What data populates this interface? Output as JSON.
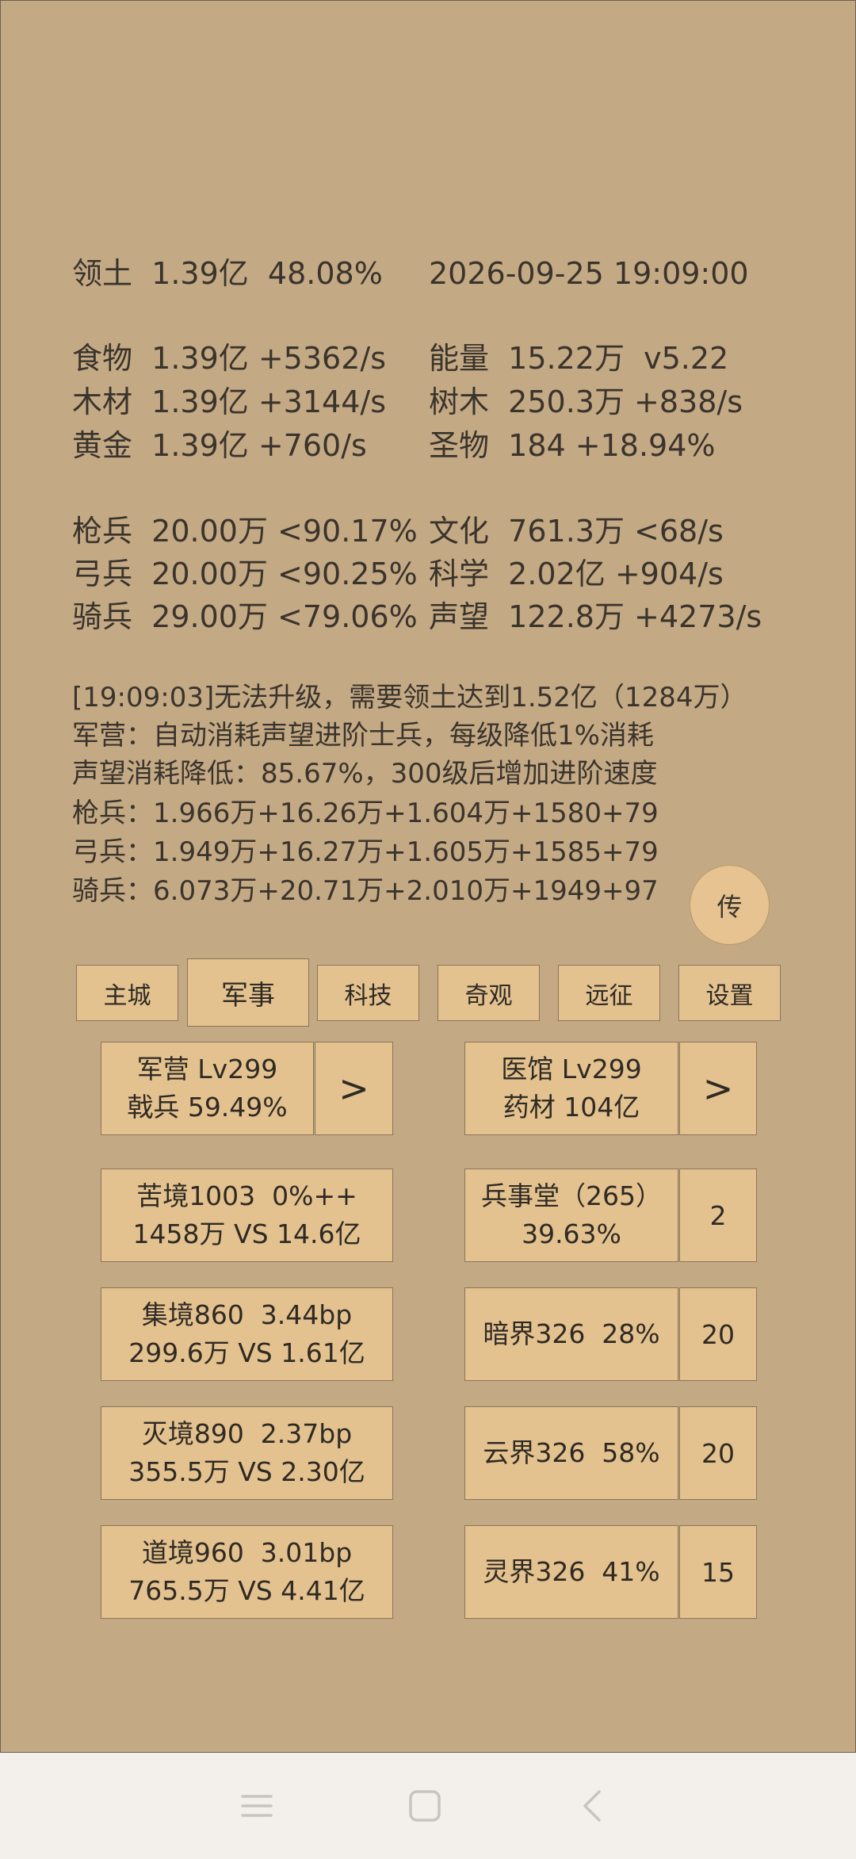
{
  "header": {
    "territory": "领土  1.39亿  48.08%",
    "datetime": "2026-09-25 19:09:00"
  },
  "resources_left": [
    "食物  1.39亿 +5362/s",
    "木材  1.39亿 +3144/s",
    "黄金  1.39亿 +760/s"
  ],
  "resources_right": [
    "能量  15.22万  v5.22",
    "树木  250.3万 +838/s",
    "圣物  184 +18.94%"
  ],
  "troops_left": [
    "枪兵  20.00万 <90.17%",
    "弓兵  20.00万 <90.25%",
    "骑兵  29.00万 <79.06%"
  ],
  "stats_right": [
    "文化  761.3万 <68/s",
    "科学  2.02亿 +904/s",
    "声望  122.8万 +4273/s"
  ],
  "log": [
    "[19:09:03]无法升级，需要领土达到1.52亿（1284万）",
    "军营：自动消耗声望进阶士兵，每级降低1%消耗",
    "声望消耗降低：85.67%，300级后增加进阶速度",
    "枪兵：1.966万+16.26万+1.604万+1580+79",
    "弓兵：1.949万+16.27万+1.605万+1585+79",
    "骑兵：6.073万+20.71万+2.010万+1949+97"
  ],
  "fab_label": "传",
  "tabs": [
    "主城",
    "军事",
    "科技",
    "奇观",
    "远征",
    "设置"
  ],
  "active_tab": "军事",
  "panels": {
    "barracks": {
      "line1": "军营 Lv299",
      "line2": "戟兵 59.49%",
      "action": ">"
    },
    "hospital": {
      "line1": "医馆 Lv299",
      "line2": "药材 104亿",
      "action": ">"
    },
    "left_cards": [
      {
        "line1": "苦境1003  0%++",
        "line2": "1458万 VS 14.6亿"
      },
      {
        "line1": "集境860  3.44bp",
        "line2": "299.6万 VS 1.61亿"
      },
      {
        "line1": "灭境890  2.37bp",
        "line2": "355.5万 VS 2.30亿"
      },
      {
        "line1": "道境960  3.01bp",
        "line2": "765.5万 VS 4.41亿"
      }
    ],
    "right_cards": [
      {
        "line1": "兵事堂（265）",
        "line2": "39.63%",
        "count": "2"
      },
      {
        "line1": "暗界326  28%",
        "line2": "",
        "count": "20"
      },
      {
        "line1": "云界326  58%",
        "line2": "",
        "count": "20"
      },
      {
        "line1": "灵界326  41%",
        "line2": "",
        "count": "15"
      }
    ]
  },
  "nav_icons": [
    "menu-icon",
    "home-square-icon",
    "back-chevron-icon"
  ],
  "colors": {
    "background": "#c4a985",
    "button": "#e3c28f",
    "navbar": "#f3efeb"
  }
}
